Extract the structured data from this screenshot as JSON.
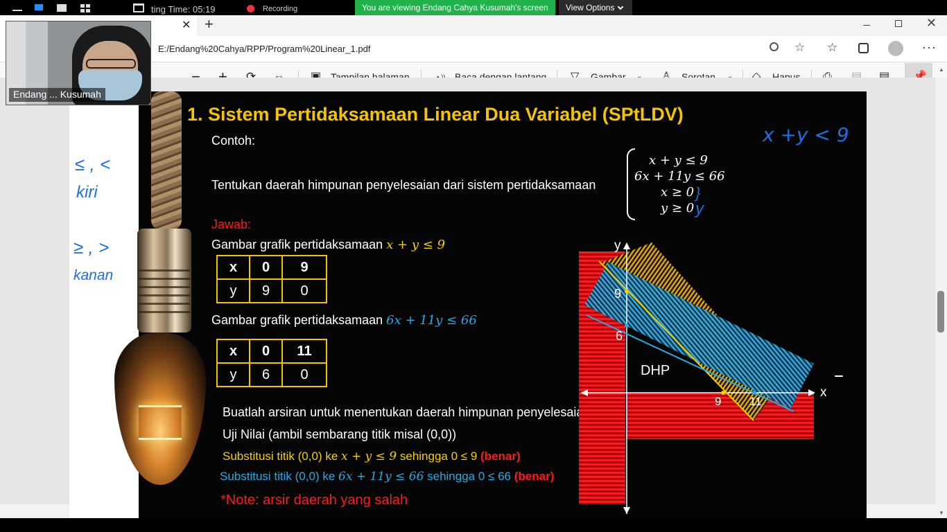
{
  "zoom": {
    "meeting_time": "ting Time: 05:19",
    "recording_label": "Recording",
    "share_banner": "You are viewing Endang Cahya Kusumah's screen",
    "view_options_label": "View Options",
    "participant_name": "Endang ... Kusumah"
  },
  "browser": {
    "url": "E:/Endang%20Cahya/RPP/Program%20Linear_1.pdf",
    "pdf_toolbar": {
      "page_view": "Tampilan halaman",
      "read_aloud": "Baca dengan lantang",
      "draw": "Gambar",
      "highlight": "Sorotan",
      "erase": "Hapus"
    }
  },
  "slide": {
    "title": "1. Sistem Pertidaksamaan Linear Dua Variabel (SPtLDV)",
    "contoh": "Contoh:",
    "prompt": "Tentukan daerah himpunan penyelesaian dari sistem pertidaksamaan",
    "system": [
      "x + y ≤ 9",
      "6x + 11y ≤ 66",
      "x ≥ 0",
      "y ≥ 0"
    ],
    "jawab": "Jawab:",
    "graph1_label": "Gambar grafik pertidaksamaan",
    "graph1_expr": "x + y ≤ 9",
    "table1": {
      "header": [
        "x",
        "0",
        "9"
      ],
      "row": [
        "y",
        "9",
        "0"
      ]
    },
    "graph2_label": "Gambar grafik pertidaksamaan",
    "graph2_expr": "6x + 11y ≤ 66",
    "table2": {
      "header": [
        "x",
        "0",
        "11"
      ],
      "row": [
        "y",
        "6",
        "0"
      ]
    },
    "instruction1": "Buatlah arsiran untuk menentukan daerah himpunan penyelesaian",
    "instruction2": "Uji Nilai (ambil sembarang titik misal (0,0))",
    "sub1_text": "Substitusi titik (0,0) ke",
    "sub1_expr": "x + y ≤ 9",
    "sub1_then": "sehingga 0 ≤ 9",
    "sub1_result": "(benar)",
    "sub2_text": "Substitusi titik (0,0) ke",
    "sub2_expr": "6x + 11y ≤ 66",
    "sub2_then": "sehingga 0 ≤ 66",
    "sub2_result": "(benar)",
    "note": "*Note: arsir daerah yang salah",
    "graph": {
      "x_label": "x",
      "y_label": "y",
      "x_ticks": [
        "9",
        "11"
      ],
      "y_ticks": [
        "9",
        "6"
      ],
      "region_label": "DHP"
    }
  },
  "handwriting": {
    "top_right": "x +y < 9",
    "left_1": "≤ , <",
    "left_2": "kiri",
    "left_3": "≥ , >",
    "left_4": "kanan",
    "annot_x": "}",
    "annot_y": "y"
  },
  "colors": {
    "title_yellow": "#f5c400",
    "line1_yellow": "#f5d000",
    "line2_blue": "#29a9e6",
    "red": "#ff1a1a",
    "banner_green": "#22b24c",
    "ink_blue": "#1e6fe0"
  }
}
